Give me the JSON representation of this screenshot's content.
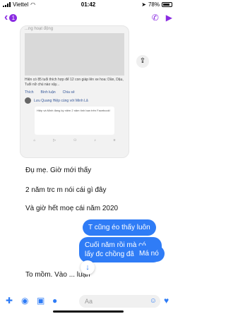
{
  "status": {
    "carrier": "Viettel",
    "time": "01:42",
    "battery": "78%"
  },
  "header": {
    "unread_count": "1"
  },
  "shared_post": {
    "header_text": "...ng hoạt động",
    "caption": "Hiện có 85 tuổi thích hợp để 12 con giáp lên xe hoa: Dần, Dậu, Tuổi nữ chú nào vậy...",
    "action_like": "Thích",
    "action_comment": "Bình luận",
    "action_share": "Chia sẻ",
    "user_line": "Lưu Quang Hiệp cùng với Minh Lã",
    "inner_text": "Hiệp và Minh đang kỷ niệm 2 năm tình bạn trên Facebook!"
  },
  "messages": [
    {
      "text": "Đụ mẹ. Giờ mới thấy",
      "side": "received"
    },
    {
      "text": "2 năm trc m nói cái gì đây",
      "side": "received"
    },
    {
      "text": "Và giờ hết moẹ cái năm 2020",
      "side": "received"
    },
    {
      "text": "T cũng éo thấy luôn",
      "side": "sent"
    },
    {
      "text": "Cuối năm rồi mà có lấy đc chồng đâu",
      "side": "sent"
    },
    {
      "text": "Má nó",
      "side": "sent"
    },
    {
      "text": "To mồm. Vào ... luận",
      "side": "received"
    }
  ],
  "composer": {
    "placeholder": "Aa"
  },
  "colors": {
    "accent": "#8a2be2",
    "sent_bubble": "#2f7cf6"
  }
}
